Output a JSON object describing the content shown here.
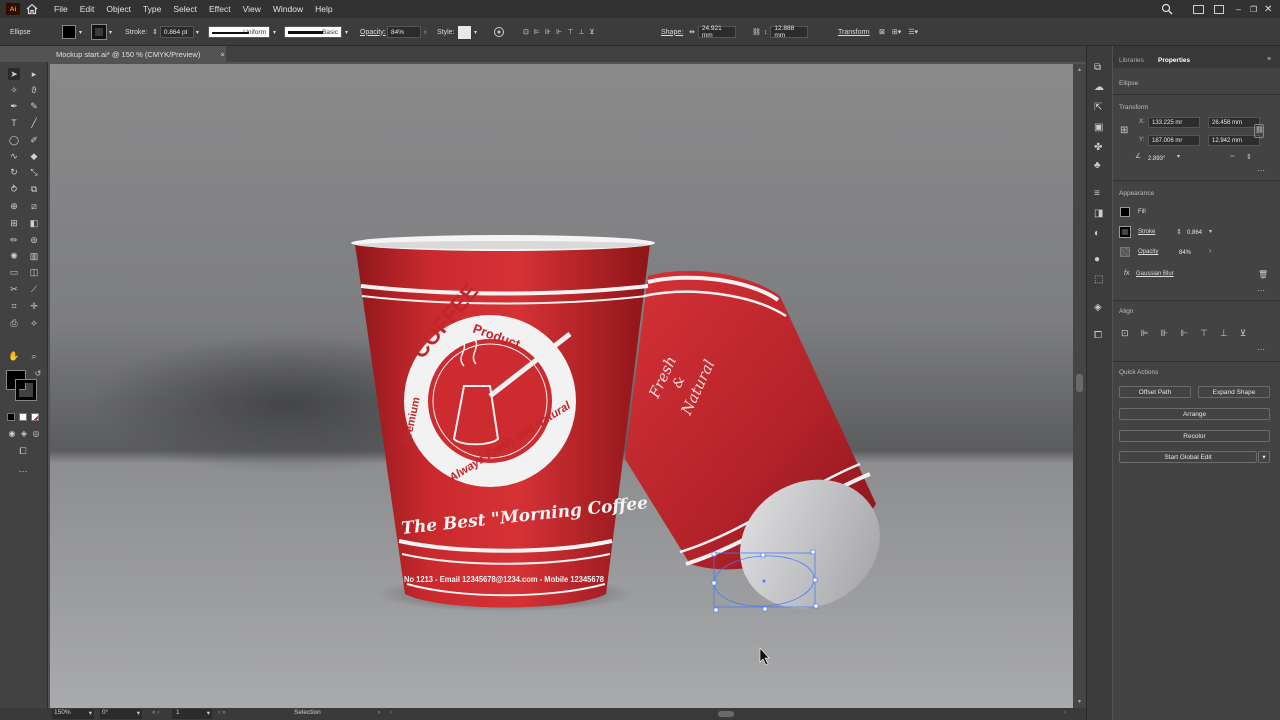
{
  "menubar": {
    "logo": "Ai",
    "items": [
      "File",
      "Edit",
      "Object",
      "Type",
      "Select",
      "Effect",
      "View",
      "Window",
      "Help"
    ]
  },
  "control": {
    "selection_label": "Ellipse",
    "stroke_label": "Stroke:",
    "stroke_value": "0.864 pt",
    "profile_uniform": "Uniform",
    "brush_basic": "Basic",
    "opacity_label": "Opacity:",
    "opacity_value": "84%",
    "style_label": "Style:",
    "shape_label": "Shape:",
    "shape_w": "24.921 mm",
    "shape_h": "12.888 mm",
    "transform_label": "Transform"
  },
  "document": {
    "tab_title": "Mockup start.ai* @ 150 % (CMYK/Preview)",
    "close": "×"
  },
  "artwork": {
    "badge_coffee": "COFFEE",
    "badge_product": "Product",
    "badge_premium": "Premium",
    "badge_always": "Always Fresh and Natural",
    "tagline": "The Best \"Morning Coffee",
    "contact": "No 1213 - Email 12345678@1234.com - Mobile 12345678",
    "side_text_1": "Fresh",
    "side_text_2": "&",
    "side_text_3": "Natural"
  },
  "status": {
    "zoom": "150%",
    "rotation": "0°",
    "artboard": "1",
    "tool": "Selection"
  },
  "panel": {
    "tab_libraries": "Libraries",
    "tab_properties": "Properties",
    "object_type": "Ellipse",
    "transform_title": "Transform",
    "x_label": "X:",
    "x_value": "133.225 mr",
    "y_label": "Y:",
    "y_value": "187.006 mr",
    "w_label": "W:",
    "w_value": "26.458 mm",
    "h_label": "H:",
    "h_value": "12.942 mm",
    "angle_value": "2.893°",
    "appearance_title": "Appearance",
    "fill_label": "Fill",
    "stroke_label": "Stroke",
    "stroke_value": "0.864",
    "opacity_label": "Opacity",
    "opacity_value": "84%",
    "effect_label": "Gaussian Blur",
    "align_title": "Align",
    "quick_actions_title": "Quick Actions",
    "btn_offset_path": "Offset Path",
    "btn_expand_shape": "Expand Shape",
    "btn_arrange": "Arrange",
    "btn_recolor": "Recolor",
    "btn_global_edit": "Start Global Edit"
  },
  "colors": {
    "cup_red": "#c1262a",
    "selection_blue": "#4a7bf5",
    "ui_dark": "#323232",
    "panel_bg": "#434343"
  }
}
